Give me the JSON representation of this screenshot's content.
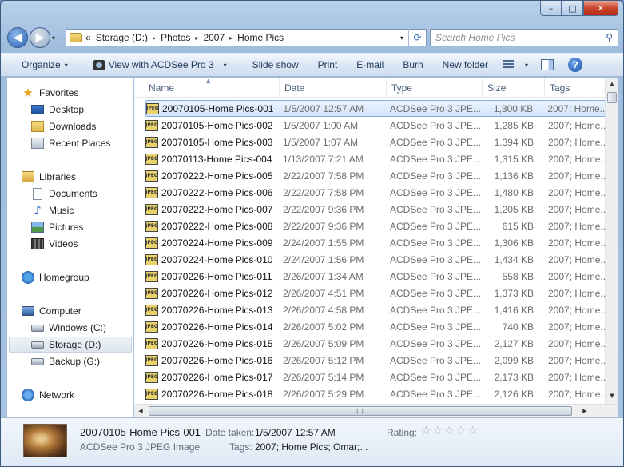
{
  "window": {
    "caption_minimize": "–",
    "caption_maximize": "□",
    "caption_close": "✕"
  },
  "address": {
    "overflow": "«",
    "crumbs": [
      "Storage (D:)",
      "Photos",
      "2007",
      "Home Pics"
    ],
    "sep": "▸",
    "chevron": "▾",
    "refresh": "⟳",
    "search_placeholder": "Search Home Pics",
    "search_icon": "⚲"
  },
  "nav_buttons": {
    "back": "◀",
    "forward": "▶",
    "dropdown": "▾"
  },
  "toolbar": {
    "organize": "Organize",
    "view_with": "View with ACDSee Pro 3",
    "slideshow": "Slide show",
    "print": "Print",
    "email": "E-mail",
    "burn": "Burn",
    "new_folder": "New folder",
    "dd": "▾",
    "help": "?"
  },
  "nav_pane": {
    "favorites": "Favorites",
    "desktop": "Desktop",
    "downloads": "Downloads",
    "recent": "Recent Places",
    "libraries": "Libraries",
    "documents": "Documents",
    "music": "Music",
    "pictures": "Pictures",
    "videos": "Videos",
    "homegroup": "Homegroup",
    "computer": "Computer",
    "windows_c": "Windows (C:)",
    "storage_d": "Storage (D:)",
    "backup_g": "Backup (G:)",
    "network": "Network",
    "star_glyph": "★",
    "music_glyph": "♪"
  },
  "columns": {
    "name": "Name",
    "date": "Date",
    "type": "Type",
    "size": "Size",
    "tags": "Tags",
    "sort_glyph": "▲"
  },
  "files": [
    {
      "name": "20070105-Home Pics-001",
      "date": "1/5/2007 12:57 AM",
      "type": "ACDSee Pro 3 JPE...",
      "size": "1,300 KB",
      "tags": "2007; Home..."
    },
    {
      "name": "20070105-Home Pics-002",
      "date": "1/5/2007 1:00 AM",
      "type": "ACDSee Pro 3 JPE...",
      "size": "1,285 KB",
      "tags": "2007; Home..."
    },
    {
      "name": "20070105-Home Pics-003",
      "date": "1/5/2007 1:07 AM",
      "type": "ACDSee Pro 3 JPE...",
      "size": "1,394 KB",
      "tags": "2007; Home..."
    },
    {
      "name": "20070113-Home Pics-004",
      "date": "1/13/2007 7:21 AM",
      "type": "ACDSee Pro 3 JPE...",
      "size": "1,315 KB",
      "tags": "2007; Home..."
    },
    {
      "name": "20070222-Home Pics-005",
      "date": "2/22/2007 7:58 PM",
      "type": "ACDSee Pro 3 JPE...",
      "size": "1,136 KB",
      "tags": "2007; Home..."
    },
    {
      "name": "20070222-Home Pics-006",
      "date": "2/22/2007 7:58 PM",
      "type": "ACDSee Pro 3 JPE...",
      "size": "1,480 KB",
      "tags": "2007; Home..."
    },
    {
      "name": "20070222-Home Pics-007",
      "date": "2/22/2007 9:36 PM",
      "type": "ACDSee Pro 3 JPE...",
      "size": "1,205 KB",
      "tags": "2007; Home..."
    },
    {
      "name": "20070222-Home Pics-008",
      "date": "2/22/2007 9:36 PM",
      "type": "ACDSee Pro 3 JPE...",
      "size": "615 KB",
      "tags": "2007; Home..."
    },
    {
      "name": "20070224-Home Pics-009",
      "date": "2/24/2007 1:55 PM",
      "type": "ACDSee Pro 3 JPE...",
      "size": "1,306 KB",
      "tags": "2007; Home..."
    },
    {
      "name": "20070224-Home Pics-010",
      "date": "2/24/2007 1:56 PM",
      "type": "ACDSee Pro 3 JPE...",
      "size": "1,434 KB",
      "tags": "2007; Home..."
    },
    {
      "name": "20070226-Home Pics-011",
      "date": "2/26/2007 1:34 AM",
      "type": "ACDSee Pro 3 JPE...",
      "size": "558 KB",
      "tags": "2007; Home..."
    },
    {
      "name": "20070226-Home Pics-012",
      "date": "2/26/2007 4:51 PM",
      "type": "ACDSee Pro 3 JPE...",
      "size": "1,373 KB",
      "tags": "2007; Home..."
    },
    {
      "name": "20070226-Home Pics-013",
      "date": "2/26/2007 4:58 PM",
      "type": "ACDSee Pro 3 JPE...",
      "size": "1,416 KB",
      "tags": "2007; Home..."
    },
    {
      "name": "20070226-Home Pics-014",
      "date": "2/26/2007 5:02 PM",
      "type": "ACDSee Pro 3 JPE...",
      "size": "740 KB",
      "tags": "2007; Home..."
    },
    {
      "name": "20070226-Home Pics-015",
      "date": "2/26/2007 5:09 PM",
      "type": "ACDSee Pro 3 JPE...",
      "size": "2,127 KB",
      "tags": "2007; Home..."
    },
    {
      "name": "20070226-Home Pics-016",
      "date": "2/26/2007 5:12 PM",
      "type": "ACDSee Pro 3 JPE...",
      "size": "2,099 KB",
      "tags": "2007; Home..."
    },
    {
      "name": "20070226-Home Pics-017",
      "date": "2/26/2007 5:14 PM",
      "type": "ACDSee Pro 3 JPE...",
      "size": "2,173 KB",
      "tags": "2007; Home..."
    },
    {
      "name": "20070226-Home Pics-018",
      "date": "2/26/2007 5:29 PM",
      "type": "ACDSee Pro 3 JPE...",
      "size": "2,126 KB",
      "tags": "2007; Home..."
    }
  ],
  "file_icon_label": "JPEG",
  "scroll": {
    "up": "▲",
    "down": "▼",
    "left": "◀",
    "right": "▶",
    "grip": "|||"
  },
  "details": {
    "name": "20070105-Home Pics-001",
    "type": "ACDSee Pro 3 JPEG Image",
    "date_label": "Date taken:",
    "date_value": "1/5/2007 12:57 AM",
    "tags_label": "Tags:",
    "tags_value": "2007; Home Pics; Omar;...",
    "rating_label": "Rating:",
    "stars": "☆☆☆☆☆"
  }
}
